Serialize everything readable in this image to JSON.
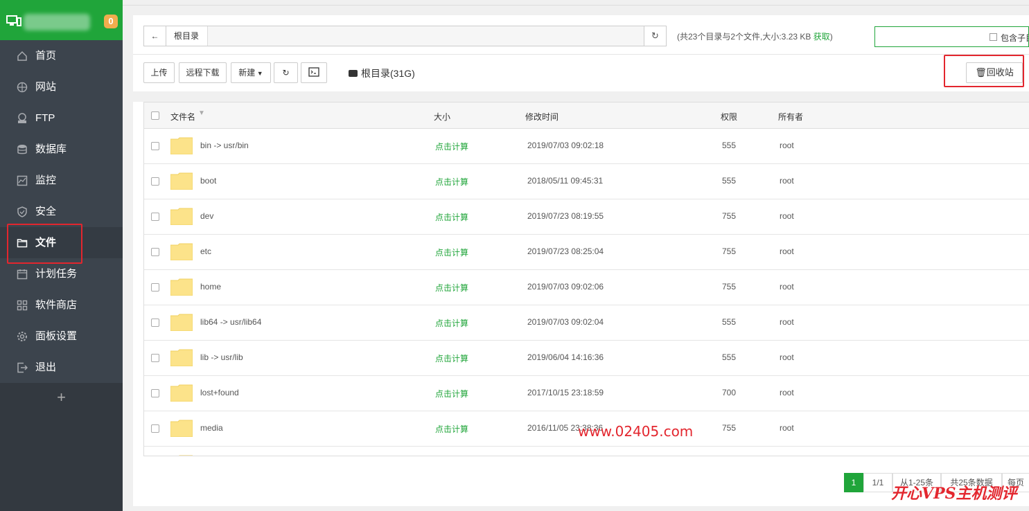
{
  "sidebar": {
    "badge": "0",
    "items": [
      {
        "label": "首页",
        "icon": "home-icon"
      },
      {
        "label": "网站",
        "icon": "globe-icon"
      },
      {
        "label": "FTP",
        "icon": "ftp-icon"
      },
      {
        "label": "数据库",
        "icon": "database-icon"
      },
      {
        "label": "监控",
        "icon": "monitor-icon"
      },
      {
        "label": "安全",
        "icon": "shield-icon"
      },
      {
        "label": "文件",
        "icon": "folder-icon",
        "active": true
      },
      {
        "label": "计划任务",
        "icon": "calendar-icon"
      },
      {
        "label": "软件商店",
        "icon": "apps-icon"
      },
      {
        "label": "面板设置",
        "icon": "gear-icon"
      },
      {
        "label": "退出",
        "icon": "logout-icon"
      }
    ],
    "add": "+"
  },
  "pathbar": {
    "back": "←",
    "crumb": "根目录",
    "refresh": "↻",
    "stat": "(共23个目录与2个文件,大小:3.23 KB ",
    "stat_link": "获取",
    "stat_end": ")"
  },
  "search": {
    "include_sub": "包含子目"
  },
  "toolbar": {
    "upload": "上传",
    "remote_download": "远程下载",
    "new": "新建",
    "disk": "根目录(31G)",
    "recycle": "回收站"
  },
  "table": {
    "headers": {
      "name": "文件名",
      "size": "大小",
      "mtime": "修改时间",
      "perm": "权限",
      "owner": "所有者"
    },
    "rows": [
      {
        "name": "bin -> usr/bin",
        "size": "点击计算",
        "mtime": "2019/07/03 09:02:18",
        "perm": "555",
        "owner": "root"
      },
      {
        "name": "boot",
        "size": "点击计算",
        "mtime": "2018/05/11 09:45:31",
        "perm": "555",
        "owner": "root"
      },
      {
        "name": "dev",
        "size": "点击计算",
        "mtime": "2019/07/23 08:19:55",
        "perm": "755",
        "owner": "root"
      },
      {
        "name": "etc",
        "size": "点击计算",
        "mtime": "2019/07/23 08:25:04",
        "perm": "755",
        "owner": "root"
      },
      {
        "name": "home",
        "size": "点击计算",
        "mtime": "2019/07/03 09:02:06",
        "perm": "755",
        "owner": "root"
      },
      {
        "name": "lib64 -> usr/lib64",
        "size": "点击计算",
        "mtime": "2019/07/03 09:02:04",
        "perm": "555",
        "owner": "root"
      },
      {
        "name": "lib -> usr/lib",
        "size": "点击计算",
        "mtime": "2019/06/04 14:16:36",
        "perm": "555",
        "owner": "root"
      },
      {
        "name": "lost+found",
        "size": "点击计算",
        "mtime": "2017/10/15 23:18:59",
        "perm": "700",
        "owner": "root"
      },
      {
        "name": "media",
        "size": "点击计算",
        "mtime": "2016/11/05 23:38:36",
        "perm": "755",
        "owner": "root"
      }
    ]
  },
  "pagination": {
    "current": "1",
    "pages": "1/1",
    "range": "从1-25条",
    "total": "共25条数据",
    "per_page": "每页"
  },
  "watermark": {
    "url": "www.02405.com",
    "brand": "开心VPS主机测评"
  },
  "colors": {
    "accent": "#20a53a",
    "sidebar": "#3c444d",
    "highlight": "#e3262e"
  }
}
